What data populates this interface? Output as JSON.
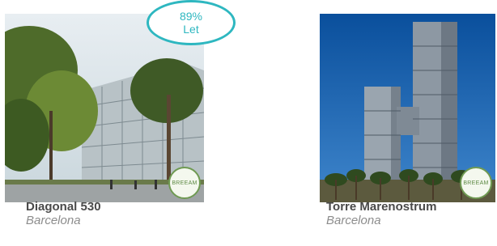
{
  "properties": [
    {
      "name": "Diagonal 530",
      "city": "Barcelona",
      "occupancy_value": "89%",
      "occupancy_label": "Let",
      "certification": "BREEAM"
    },
    {
      "name": "Torre Marenostrum",
      "city": "Barcelona",
      "certification": "BREEAM"
    }
  ],
  "colors": {
    "accent": "#2eb7c0",
    "title": "#4a4a4a",
    "subtitle": "#8c8c8c",
    "breeam": "#6f9a52"
  }
}
